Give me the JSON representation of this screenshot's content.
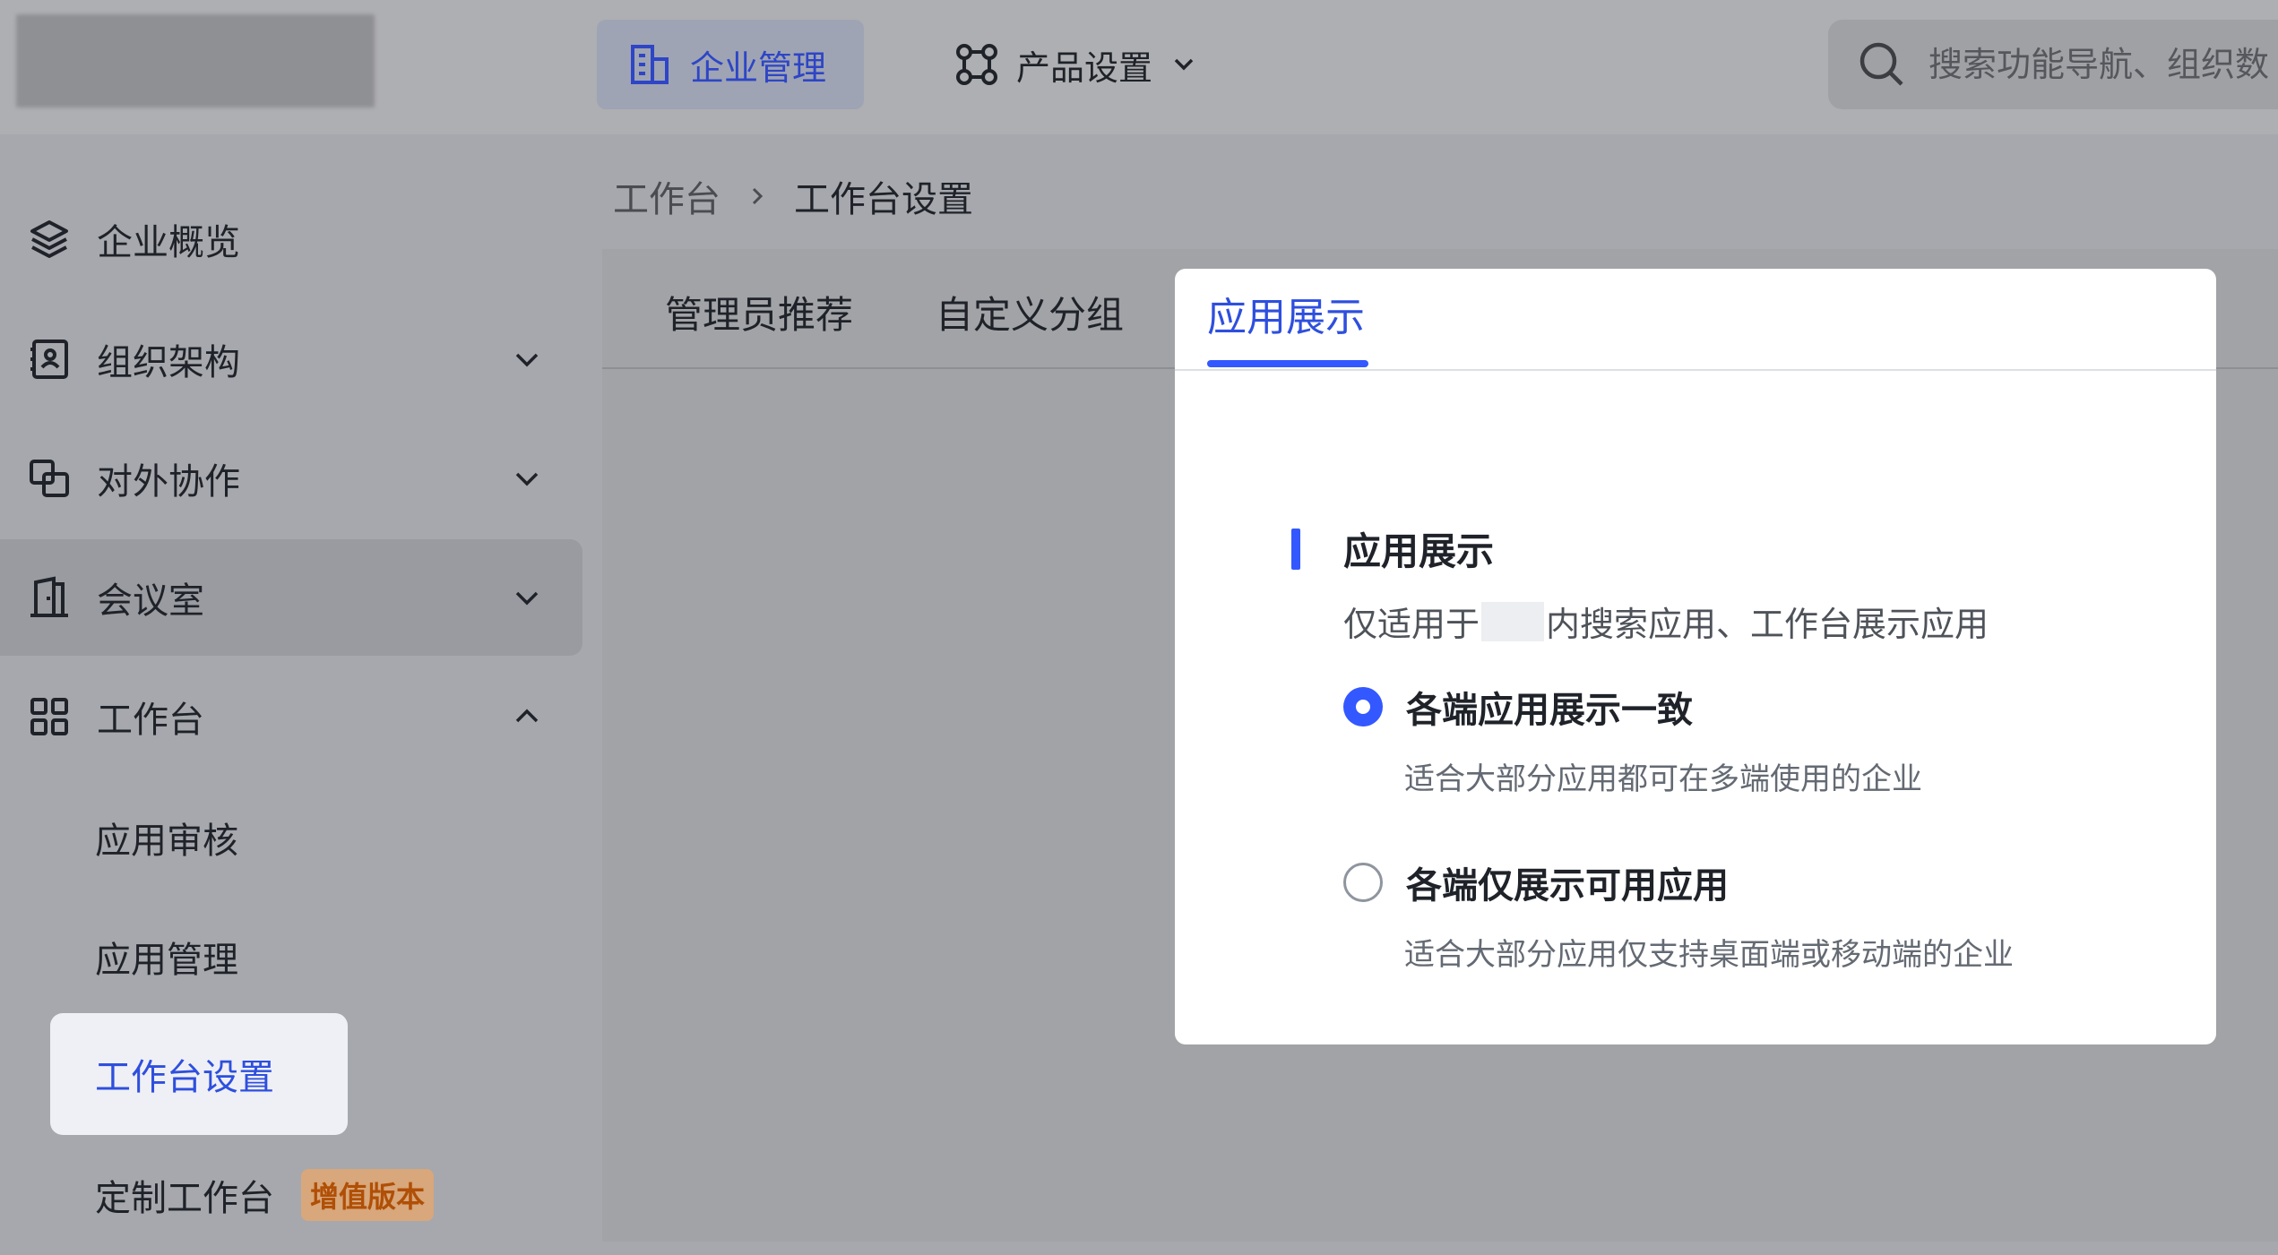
{
  "header": {
    "enterprise_label": "企业管理",
    "product_label": "产品设置",
    "search_placeholder": "搜索功能导航、组织数"
  },
  "sidebar": {
    "items": [
      {
        "label": "企业概览"
      },
      {
        "label": "组织架构"
      },
      {
        "label": "对外协作"
      },
      {
        "label": "会议室"
      },
      {
        "label": "工作台"
      }
    ],
    "sub_items": [
      {
        "label": "应用审核"
      },
      {
        "label": "应用管理"
      },
      {
        "label": "工作台设置"
      },
      {
        "label": "定制工作台",
        "badge": "增值版本"
      }
    ]
  },
  "breadcrumb": {
    "root": "工作台",
    "current": "工作台设置"
  },
  "tabs": [
    "管理员推荐",
    "自定义分组",
    "应用展示"
  ],
  "panel": {
    "section_title": "应用展示",
    "desc_prefix": "仅适用于",
    "desc_suffix": "内搜索应用、工作台展示应用",
    "options": [
      {
        "label": "各端应用展示一致",
        "desc": "适合大部分应用都可在多端使用的企业",
        "selected": true
      },
      {
        "label": "各端仅展示可用应用",
        "desc": "适合大部分应用仅支持桌面端或移动端的企业",
        "selected": false
      }
    ]
  },
  "colors": {
    "accent": "#3358ff",
    "badge_text": "#b04f06"
  }
}
